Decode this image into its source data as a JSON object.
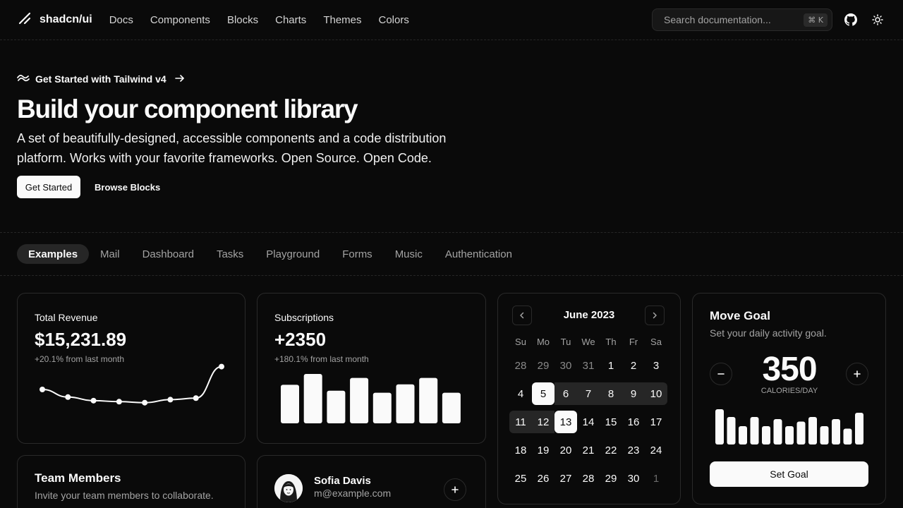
{
  "header": {
    "brand": "shadcn/ui",
    "nav": [
      "Docs",
      "Components",
      "Blocks",
      "Charts",
      "Themes",
      "Colors"
    ],
    "search_placeholder": "Search documentation...",
    "search_shortcut": "⌘ K"
  },
  "hero": {
    "announcement": "Get Started with Tailwind v4",
    "title": "Build your component library",
    "description": "A set of beautifully-designed, accessible components and a code distribution platform. Works with your favorite frameworks. Open Source. Open Code.",
    "primary_button": "Get Started",
    "secondary_button": "Browse Blocks"
  },
  "tabs": [
    "Examples",
    "Mail",
    "Dashboard",
    "Tasks",
    "Playground",
    "Forms",
    "Music",
    "Authentication"
  ],
  "active_tab": "Examples",
  "revenue": {
    "label": "Total Revenue",
    "value": "$15,231.89",
    "change": "+20.1% from last month",
    "trend": [
      0.5,
      0.35,
      0.28,
      0.26,
      0.24,
      0.3,
      0.33,
      0.95
    ]
  },
  "subscriptions": {
    "label": "Subscriptions",
    "value": "+2350",
    "change": "+180.1% from last month",
    "bars": [
      0.78,
      1.0,
      0.66,
      0.92,
      0.62,
      0.79,
      0.92,
      0.62
    ]
  },
  "calendar": {
    "title": "June 2023",
    "weekdays": [
      "Su",
      "Mo",
      "Tu",
      "We",
      "Th",
      "Fr",
      "Sa"
    ],
    "weeks": [
      [
        "28",
        "29",
        "30",
        "31",
        "1",
        "2",
        "3"
      ],
      [
        "4",
        "5",
        "6",
        "7",
        "8",
        "9",
        "10"
      ],
      [
        "11",
        "12",
        "13",
        "14",
        "15",
        "16",
        "17"
      ],
      [
        "18",
        "19",
        "20",
        "21",
        "22",
        "23",
        "24"
      ],
      [
        "25",
        "26",
        "27",
        "28",
        "29",
        "30",
        "1"
      ]
    ],
    "range_start": "5",
    "range_end": "13"
  },
  "goal": {
    "title": "Move Goal",
    "description": "Set your daily activity goal.",
    "value": "350",
    "unit": "CALORIES/DAY",
    "button": "Set Goal",
    "bars": [
      1.0,
      0.78,
      0.52,
      0.78,
      0.52,
      0.72,
      0.52,
      0.65,
      0.78,
      0.52,
      0.72,
      0.45,
      0.9
    ]
  },
  "team": {
    "title": "Team Members",
    "description": "Invite your team members to collaborate."
  },
  "person": {
    "name": "Sofia Davis",
    "email": "m@example.com"
  },
  "colors": {
    "background": "#0a0a0a",
    "foreground": "#fafafa",
    "muted": "#a3a3a3",
    "border": "#2a2a2a"
  }
}
